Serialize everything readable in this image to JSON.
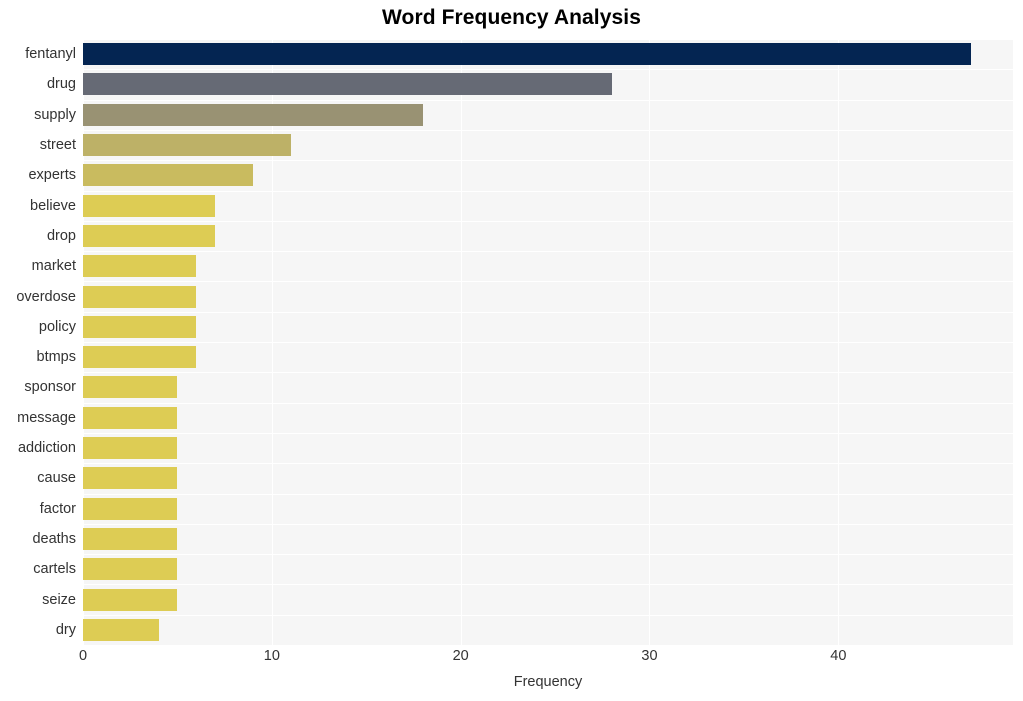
{
  "chart_data": {
    "type": "bar",
    "orientation": "horizontal",
    "title": "Word Frequency Analysis",
    "xlabel": "Frequency",
    "ylabel": "",
    "categories": [
      "fentanyl",
      "drug",
      "supply",
      "street",
      "experts",
      "believe",
      "drop",
      "market",
      "overdose",
      "policy",
      "btmps",
      "sponsor",
      "message",
      "addiction",
      "cause",
      "factor",
      "deaths",
      "cartels",
      "seize",
      "dry"
    ],
    "values": [
      47,
      28,
      18,
      11,
      9,
      7,
      7,
      6,
      6,
      6,
      6,
      5,
      5,
      5,
      5,
      5,
      5,
      5,
      5,
      4
    ],
    "bar_colors": [
      "#042552",
      "#666a75",
      "#999273",
      "#bdb167",
      "#c9bb5f",
      "#ddcc54",
      "#ddcc54",
      "#ddcc54",
      "#ddcc54",
      "#ddcc54",
      "#ddcc54",
      "#ddcc54",
      "#ddcc54",
      "#ddcc54",
      "#ddcc54",
      "#ddcc54",
      "#ddcc54",
      "#ddcc54",
      "#ddcc54",
      "#ddcc54"
    ],
    "xlim": [
      0,
      49.25
    ],
    "xticks": [
      0,
      10,
      20,
      30,
      40
    ],
    "xtick_labels": [
      "0",
      "10",
      "20",
      "30",
      "40"
    ],
    "grid": true,
    "grid_color": "#ffffff",
    "plot_background": "#f6f6f6",
    "figure_background": "#ffffff",
    "legend": null,
    "title_color": "#000000",
    "tick_label_color": "#333333"
  }
}
